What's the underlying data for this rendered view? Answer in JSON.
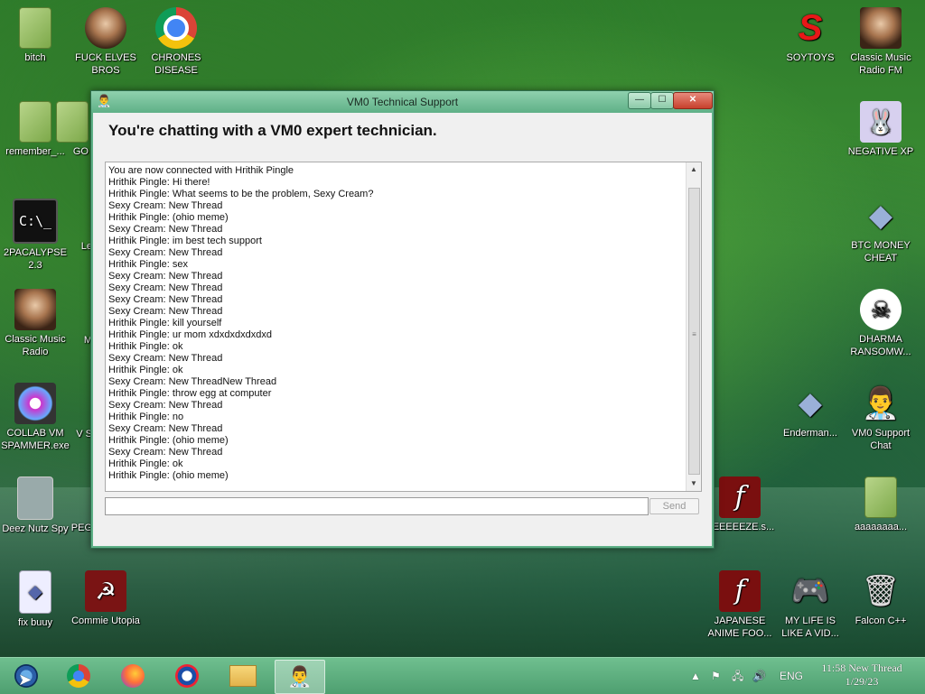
{
  "desktop": {
    "icons": [
      {
        "label": "bitch",
        "icon": "folder-icon"
      },
      {
        "label": "FUCK ELVES BROS",
        "icon": "elf-icon"
      },
      {
        "label": "CHRONES DISEASE",
        "icon": "chrome-icon"
      },
      {
        "label": "remember_...",
        "icon": "folder-icon"
      },
      {
        "label": "GO",
        "icon": "folder-icon"
      },
      {
        "label": "2PACALYPSE 2.3",
        "icon": "cmd-icon"
      },
      {
        "label": "Le",
        "icon": "generic-icon"
      },
      {
        "label": "Classic Music Radio",
        "icon": "portrait-icon"
      },
      {
        "label": "M",
        "icon": "generic-icon"
      },
      {
        "label": "COLLAB VM SPAMMER.exe",
        "icon": "spammer-icon"
      },
      {
        "label": "V S",
        "icon": "generic-icon"
      },
      {
        "label": "Deez Nutz Spy",
        "icon": "stack-icon"
      },
      {
        "label": "PEG",
        "icon": "gear-icon"
      },
      {
        "label": "fix buuy",
        "icon": "document-icon"
      },
      {
        "label": "Commie Utopia",
        "icon": "commie-icon"
      },
      {
        "label": "SOYTOYS",
        "icon": "soytoys-icon"
      },
      {
        "label": "Classic Music Radio FM",
        "icon": "portrait-icon"
      },
      {
        "label": "NEGATIVE XP",
        "icon": "bunny-icon"
      },
      {
        "label": "BTC MONEY CHEAT",
        "icon": "crystal-icon"
      },
      {
        "label": "DHARMA RANSOMW...",
        "icon": "skull-icon"
      },
      {
        "label": "Enderman...",
        "icon": "crystal-icon"
      },
      {
        "label": "VM0 Support Chat",
        "icon": "doctor-icon"
      },
      {
        "label": "REEEEEZE.s...",
        "icon": "flash-icon"
      },
      {
        "label": "aaaaaaaa...",
        "icon": "folder-icon"
      },
      {
        "label": "JAPANESE ANIME FOO...",
        "icon": "flash-icon"
      },
      {
        "label": "MY LIFE IS LIKE A VID...",
        "icon": "gamepad-icon"
      },
      {
        "label": "Falcon C++",
        "icon": "recycle-bin-icon"
      }
    ]
  },
  "window": {
    "title": "VM0 Technical Support",
    "heading": "You're chatting with a VM0 expert technician.",
    "chat_lines": [
      "You are now connected with Hrithik Pingle",
      "Hrithik Pingle: Hi there!",
      "Hrithik Pingle: What seems to be the problem, Sexy Cream?",
      "Sexy Cream: New Thread",
      "Hrithik Pingle: (ohio meme)",
      "Sexy Cream: New Thread",
      "Hrithik Pingle: im best tech support",
      "Sexy Cream: New Thread",
      "Hrithik Pingle: sex",
      "Sexy Cream: New Thread",
      "Sexy Cream: New Thread",
      "Sexy Cream: New Thread",
      "Sexy Cream: New Thread",
      "Hrithik Pingle: kill yourself",
      "Hrithik Pingle: ur mom xdxdxdxdxdxd",
      "Hrithik Pingle: ok",
      "Sexy Cream: New Thread",
      "Hrithik Pingle: ok",
      "Sexy Cream: New ThreadNew Thread",
      "Hrithik Pingle: throw egg at computer",
      "Sexy Cream: New Thread",
      "Hrithik Pingle: no",
      "Sexy Cream: New Thread",
      "Hrithik Pingle: (ohio meme)",
      "Sexy Cream: New Thread",
      "Hrithik Pingle: ok",
      "Hrithik Pingle: (ohio meme)"
    ],
    "input_value": "",
    "send_label": "Send",
    "minimize_glyph": "—",
    "maximize_glyph": "☐",
    "close_glyph": "✕"
  },
  "taskbar": {
    "language": "ENG",
    "time": "11:58 New Thread",
    "date": "1/29/23"
  },
  "colors": {
    "titlebar": "#5fb087",
    "taskbar": "#5aa97b"
  }
}
